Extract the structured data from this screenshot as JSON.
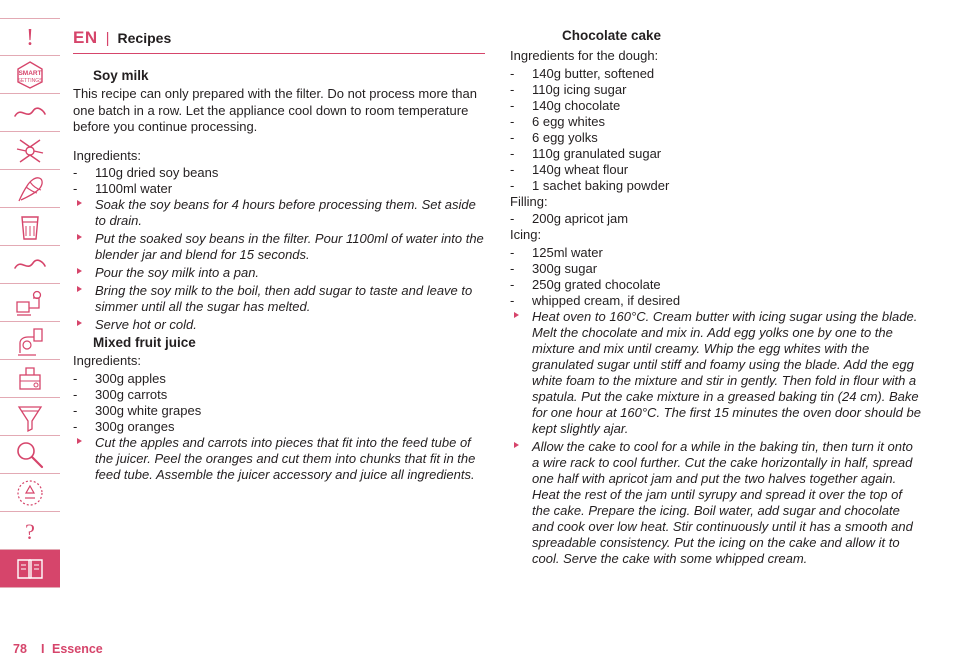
{
  "sidebar": {
    "items": [
      {
        "name": "warning-icon",
        "label": "Important / warning"
      },
      {
        "name": "smart-settings-icon",
        "label": "Smart settings"
      },
      {
        "name": "blender-jar-icon",
        "label": "Blender"
      },
      {
        "name": "chopper-blade-icon",
        "label": "Blade / chopper"
      },
      {
        "name": "whisk-icon",
        "label": "Whisk"
      },
      {
        "name": "filter-cup-icon",
        "label": "Filter"
      },
      {
        "name": "mini-chopper-icon",
        "label": "Mini chopper"
      },
      {
        "name": "grinder-icon",
        "label": "Grinder"
      },
      {
        "name": "juicer-press-icon",
        "label": "Citrus press"
      },
      {
        "name": "juicer-icon",
        "label": "Juicer"
      },
      {
        "name": "strainer-icon",
        "label": "Strainer"
      },
      {
        "name": "cleaning-brush-icon",
        "label": "Cleaning"
      },
      {
        "name": "recycling-icon",
        "label": "Recycling"
      },
      {
        "name": "help-icon",
        "label": "Help"
      },
      {
        "name": "recipes-icon",
        "label": "Recipes"
      }
    ],
    "active_index": 14,
    "accent": "#d6456b",
    "divider": "#e3aab4"
  },
  "header": {
    "language_code": "EN",
    "separator": "|",
    "title": "Recipes"
  },
  "left_column": {
    "recipes": [
      {
        "title": "Soy milk",
        "intro": "This recipe can only prepared with the filter. Do not process more than one batch in a row. Let the appliance cool down to room temperature before you continue processing.",
        "ingredients_label": "Ingredients:",
        "ingredients": [
          "110g dried soy beans",
          "1100ml water"
        ],
        "steps": [
          "Soak the soy beans for 4 hours before processing them. Set aside to drain.",
          "Put the soaked soy beans in the filter. Pour 1100ml of water into the blender jar and blend for 15 seconds.",
          "Pour the soy milk into a pan.",
          "Bring the soy milk to the boil, then add sugar to taste and leave to simmer until all the sugar has melted.",
          "Serve hot or cold."
        ]
      },
      {
        "title": "Mixed fruit juice",
        "ingredients_label": "Ingredients:",
        "ingredients": [
          "300g apples",
          "300g carrots",
          "300g white grapes",
          "300g oranges"
        ],
        "steps": [
          "Cut the apples and carrots into pieces that fit into the feed tube of the juicer. Peel the oranges and cut them into chunks that fit in the feed tube. Assemble the juicer accessory and juice all ingredients."
        ]
      }
    ]
  },
  "right_column": {
    "recipe": {
      "title": "Chocolate cake",
      "dough_label": "Ingredients for the dough:",
      "dough": [
        "140g butter, softened",
        "110g icing sugar",
        "140g chocolate",
        "6 egg whites",
        "6 egg yolks",
        "110g granulated sugar",
        "140g wheat flour",
        "1 sachet baking powder"
      ],
      "filling_label": "Filling:",
      "filling": [
        "200g apricot jam"
      ],
      "icing_label": "Icing:",
      "icing": [
        "125ml water",
        "300g sugar",
        "250g grated chocolate",
        "whipped cream, if desired"
      ],
      "steps": [
        "Heat oven to 160°C. Cream butter with icing sugar using the blade. Melt the chocolate and mix in. Add egg yolks one by one to the mixture and mix until creamy. Whip the egg whites with the granulated sugar until stiff and foamy using the blade. Add the egg white foam to the mixture and stir in gently. Then fold in flour with a spatula. Put the cake mixture in a greased baking tin (24 cm). Bake for one hour at 160°C. The first 15 minutes the oven door should be kept slightly ajar.",
        "Allow the cake to cool for a while in the baking tin, then turn it onto a wire rack to cool further. Cut the cake horizontally in half, spread one half with apricot jam and put the two halves together again. Heat the rest of the jam until syrupy and spread it over the top of the cake. Prepare the icing. Boil water, add sugar and chocolate and cook over low heat. Stir continuously until it has a smooth and spreadable consistency. Put the icing on the cake and allow it to cool. Serve the cake with some whipped cream."
      ]
    }
  },
  "footer": {
    "page_number": "78",
    "separator": "I",
    "product_name": "Essence"
  }
}
